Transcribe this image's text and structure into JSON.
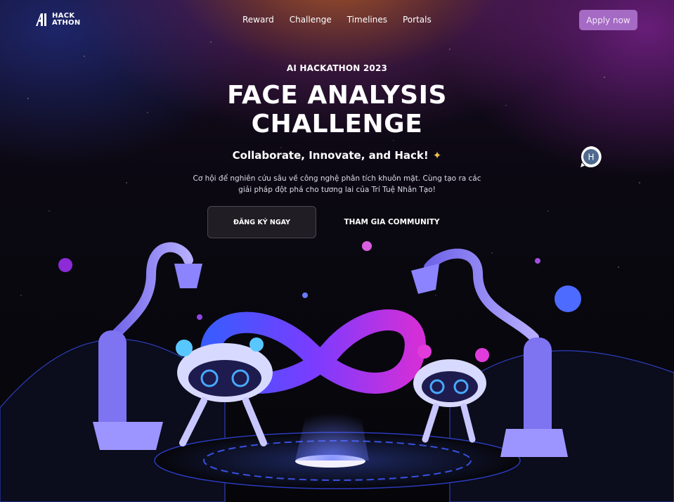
{
  "header": {
    "logo": {
      "line1": "HACK",
      "line2": "ATHON"
    },
    "nav": [
      {
        "label": "Reward"
      },
      {
        "label": "Challenge"
      },
      {
        "label": "Timelines"
      },
      {
        "label": "Portals"
      }
    ],
    "apply_label": "Apply now"
  },
  "hero": {
    "eyebrow": "AI HACKATHON 2023",
    "title_line1": "FACE ANALYSIS",
    "title_line2": "CHALLENGE",
    "subtitle": "Collaborate, Innovate, and Hack!",
    "description_line1": "Cơ hội để nghiên cứu sâu về công nghệ phân tích khuôn mặt. Cùng tạo ra các",
    "description_line2": "giải pháp đột phá cho tương lai của Trí Tuệ Nhân Tạo!",
    "register_label": "ĐĂNG KÝ NGAY",
    "community_label": "THAM GIA COMMUNITY"
  },
  "chat": {
    "initial": "H"
  },
  "icons": {
    "logo": "hackathon-logo-icon",
    "sparkle": "sparkle-icon",
    "chat": "chat-bubble-icon",
    "illustration": "robots-infinity-illustration"
  },
  "colors": {
    "accent": "#a56ac3",
    "sparkle": "#f0c24a",
    "robot_glow": "#7b6cff"
  }
}
